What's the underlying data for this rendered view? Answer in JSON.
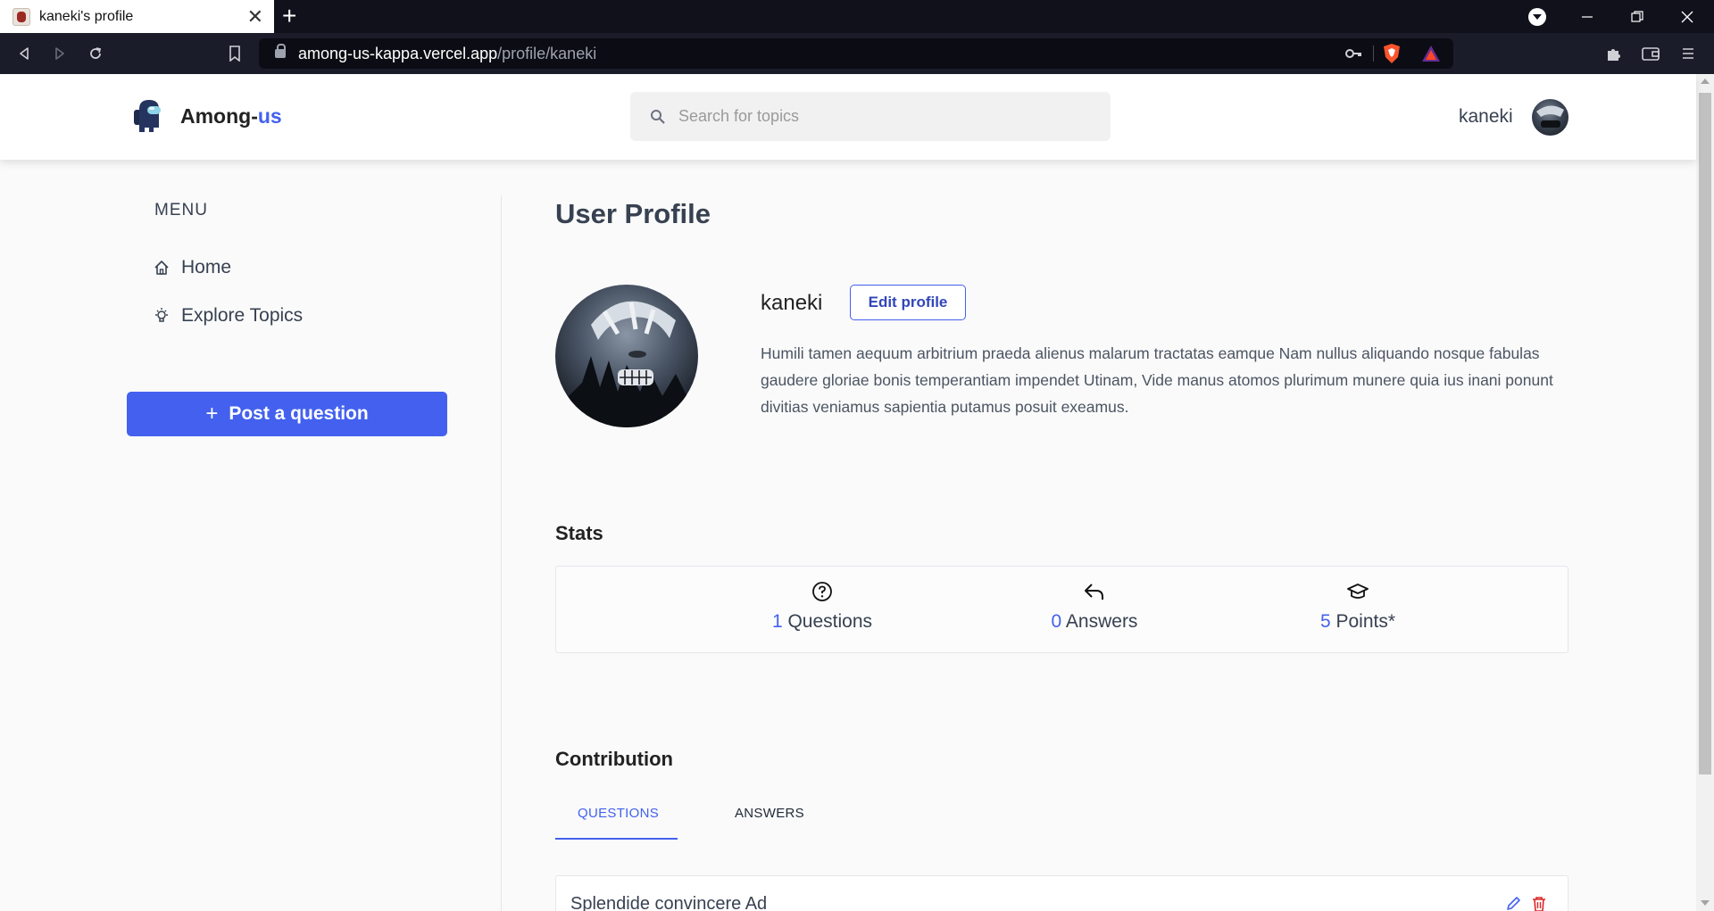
{
  "browser": {
    "tab_title": "kaneki's profile",
    "tab_close": "✕",
    "new_tab": "+",
    "url_host": "among-us-kappa.vercel.app",
    "url_path": "/profile/kaneki",
    "window_controls": [
      "minimize-icon",
      "restore-icon",
      "close-icon"
    ]
  },
  "header": {
    "brand_prefix": "Among-",
    "brand_accent": "us",
    "search_placeholder": "Search for topics",
    "username": "kaneki",
    "accent_color": "#4361ee"
  },
  "sidebar": {
    "menu_title": "MENU",
    "items": [
      {
        "label": "Home",
        "icon": "home-icon"
      },
      {
        "label": "Explore Topics",
        "icon": "lightbulb-icon"
      }
    ],
    "post_button": "Post a question"
  },
  "profile": {
    "page_title": "User Profile",
    "name": "kaneki",
    "edit_label": "Edit profile",
    "bio": "Humili tamen aequum arbitrium praeda alienus malarum tractatas eamque Nam nullus aliquando nosque fabulas gaudere gloriae bonis temperantiam impendet Utinam, Vide manus atomos plurimum munere quia ius inani ponunt divitias veniamus sapientia putamus posuit exeamus."
  },
  "stats": {
    "title": "Stats",
    "items": [
      {
        "value": "1",
        "label": " Questions",
        "icon": "question-circle-icon"
      },
      {
        "value": "0",
        "label": " Answers",
        "icon": "reply-icon"
      },
      {
        "value": "5",
        "label": " Points*",
        "icon": "graduation-cap-icon"
      }
    ]
  },
  "contribution": {
    "title": "Contribution",
    "tabs": [
      "QUESTIONS",
      "ANSWERS"
    ],
    "active_tab": "QUESTIONS",
    "questions": [
      {
        "title": "Splendide convincere Ad"
      }
    ]
  }
}
